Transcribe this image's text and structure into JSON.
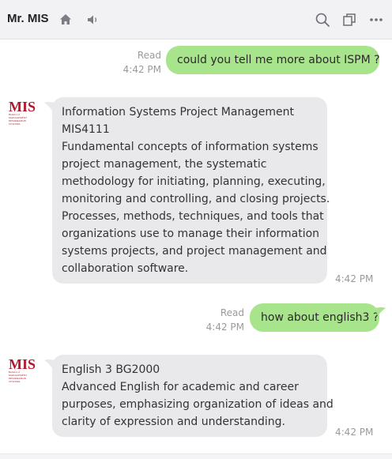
{
  "header": {
    "title": "Mr. MIS",
    "icons": [
      "home-icon",
      "speaker-icon",
      "search-icon",
      "copy-window-icon",
      "more-icon"
    ]
  },
  "messages": [
    {
      "direction": "out",
      "status": "Read",
      "time": "4:42 PM",
      "text": "could you tell me more about ISPM ?"
    },
    {
      "direction": "in",
      "sender_logo": "MIS",
      "time": "4:42 PM",
      "lines": [
        "Information Systems Project Management",
        "MIS4111",
        "Fundamental concepts of information systems",
        "project management, the systematic",
        "methodology for initiating, planning, executing,",
        "monitoring and controlling, and closing projects.",
        "Processes, methods, techniques, and tools that",
        "organizations use to manage their information",
        "systems projects, and project management and",
        "collaboration software."
      ]
    },
    {
      "direction": "out",
      "status": "Read",
      "time": "4:42 PM",
      "text": "how about english3 ?"
    },
    {
      "direction": "in",
      "sender_logo": "MIS",
      "time": "4:42 PM",
      "lines": [
        "English 3 BG2000",
        "Advanced English for academic and career",
        "purposes, emphasizing organization of ideas and",
        "clarity of expression and understanding."
      ]
    }
  ],
  "logo": {
    "text": "MIS",
    "subtext_lines": [
      "Bachelor of",
      "MANAGEMENT",
      "INFORMATION",
      "SYSTEMS"
    ],
    "color": "#b5172a"
  },
  "colors": {
    "outgoing_bubble": "#a8e48b",
    "incoming_bubble": "#e9e9ec",
    "header_bg": "#f2f2f4"
  }
}
